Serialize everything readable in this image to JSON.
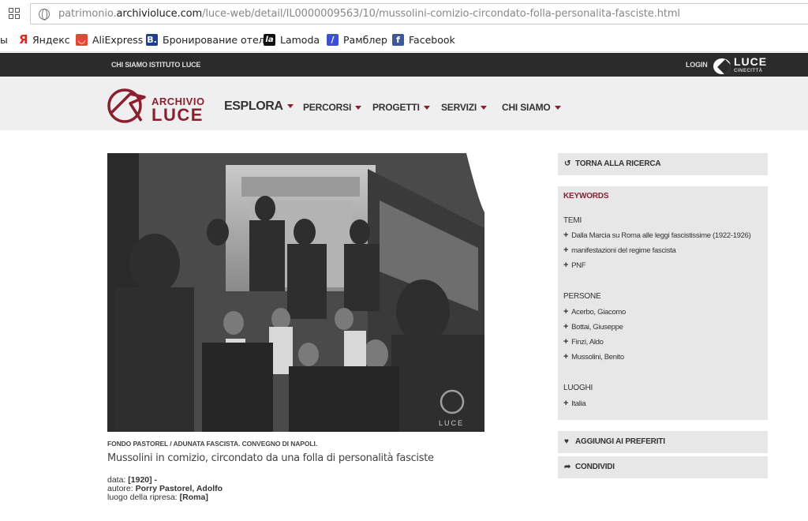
{
  "browser": {
    "url_prefix": "patrimonio.",
    "url_domain": "archivioluce.com",
    "url_path": "/luce-web/detail/IL0000009563/10/mussolini-comizio-circondato-folla-personalita-fasciste.html",
    "bookmarks": [
      {
        "label": "ы",
        "icon": ""
      },
      {
        "label": "Яндекс",
        "icon": "yandex-icon"
      },
      {
        "label": "AliExpress",
        "icon": "aliexpress-icon"
      },
      {
        "label": "Бронирование отел",
        "icon": "booking-icon"
      },
      {
        "label": "Lamoda",
        "icon": "lamoda-icon"
      },
      {
        "label": "Рамблер",
        "icon": "rambler-icon"
      },
      {
        "label": "Facebook",
        "icon": "facebook-icon"
      }
    ]
  },
  "topbar": {
    "chi_siamo": "CHI SIAMO",
    "istituto": "ISTITUTO LUCE",
    "login": "LOGIN",
    "brand": "LUCE",
    "brand_sub": "CINECITTÀ"
  },
  "logo": {
    "line1": "ARCHIVIO",
    "line2": "LUCE"
  },
  "nav": {
    "esplora": "ESPLORA",
    "percorsi": "PERCORSI",
    "progetti": "PROGETTI",
    "servizi": "SERVIZI",
    "chi_siamo": "CHI SIAMO"
  },
  "photo": {
    "watermark": "LUCE"
  },
  "caption": {
    "fondo": "FONDO PASTOREL / ADUNATA FASCISTA. CONVEGNO DI NAPOLI.",
    "title": "Mussolini in comizio, circondato da una folla di personalità fasciste",
    "data_label": "data:",
    "data_value": "[1920] -",
    "autore_label": "autore:",
    "autore_value": "Porry Pastorel, Adolfo",
    "luogo_label": "luogo della ripresa:",
    "luogo_value": "[Roma]"
  },
  "sidebar": {
    "back": "TORNA ALLA RICERCA",
    "keywords_title": "KEYWORDS",
    "temi_title": "TEMI",
    "temi": [
      "Dalla Marcia su Roma alle leggi fascistissime (1922-1926)",
      "manifestazioni del regime fascista",
      "PNF"
    ],
    "persone_title": "PERSONE",
    "persone": [
      "Acerbo, Giacomo",
      "Bottai, Giuseppe",
      "Finzi, Aldo",
      "Mussolini, Benito"
    ],
    "luoghi_title": "LUOGHI",
    "luoghi": [
      "Italia"
    ],
    "preferiti": "AGGIUNGI AI PREFERITI",
    "condividi": "CONDIVIDI"
  },
  "colors": {
    "accent": "#8b1e2f",
    "topbar": "#2b2b2b",
    "navbar": "#efefef",
    "panel": "#e7e7e7"
  }
}
